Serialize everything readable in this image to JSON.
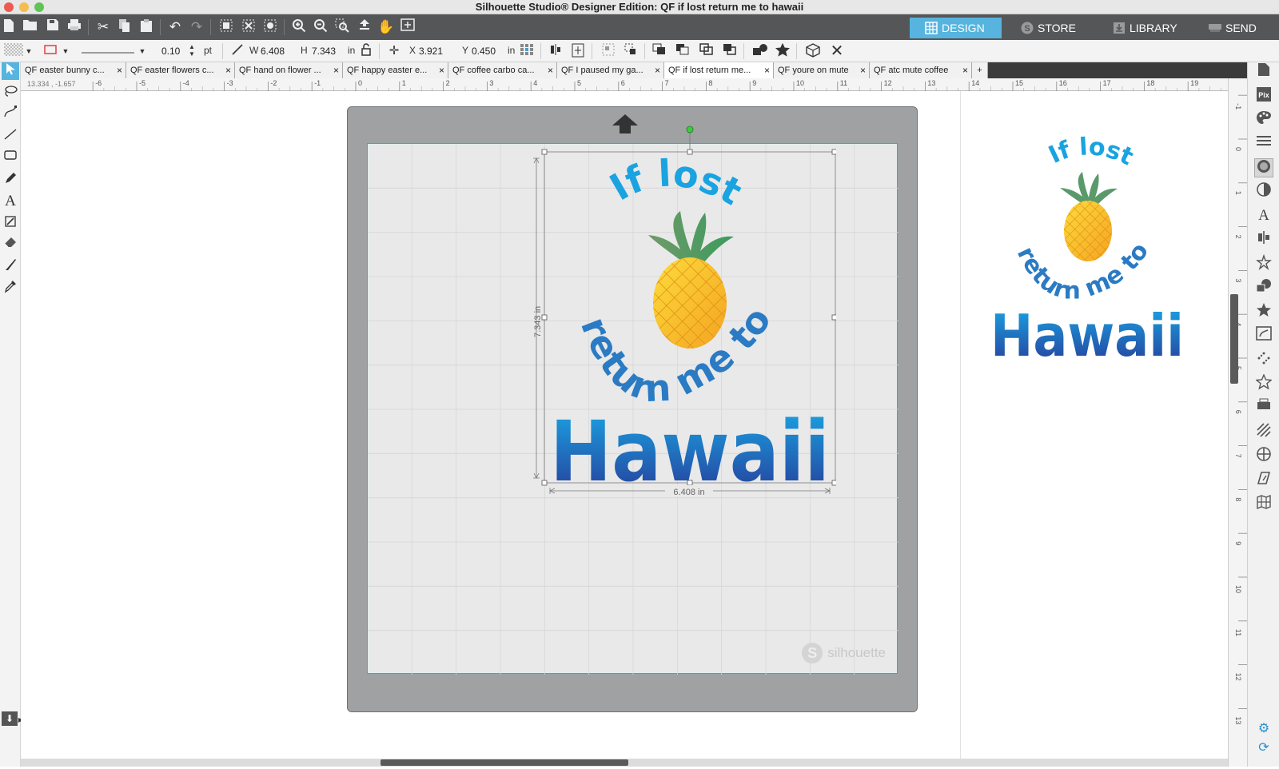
{
  "window": {
    "title": "Silhouette® Designer Edition: QF if lost return me to hawaii",
    "title_display": "Silhouette Studio® Designer Edition: QF if lost return me to hawaii"
  },
  "nav_tabs": [
    {
      "label": "DESIGN",
      "icon": "grid-icon",
      "active": true
    },
    {
      "label": "STORE",
      "icon": "silhouette-s-icon",
      "active": false
    },
    {
      "label": "LIBRARY",
      "icon": "download-icon",
      "active": false
    },
    {
      "label": "SEND",
      "icon": "cutter-icon",
      "active": false
    }
  ],
  "properties": {
    "line_width": "0.10",
    "line_unit": "pt",
    "w_label": "W",
    "width": "6.408",
    "h_label": "H",
    "height": "7.343",
    "size_unit": "in",
    "x_label": "X",
    "x": "3.921",
    "y_label": "Y",
    "y": "0.450",
    "pos_unit": "in"
  },
  "doc_tabs": [
    {
      "label": "QF easter bunny c...",
      "active": false
    },
    {
      "label": "QF easter flowers c...",
      "active": false
    },
    {
      "label": "QF hand on flower ...",
      "active": false
    },
    {
      "label": "QF happy easter e...",
      "active": false
    },
    {
      "label": "QF coffee carbo ca...",
      "active": false
    },
    {
      "label": "QF I paused my ga...",
      "active": false
    },
    {
      "label": "QF if lost return me...",
      "active": true
    },
    {
      "label": "QF youre on mute",
      "active": false
    },
    {
      "label": "QF atc mute coffee",
      "active": false
    }
  ],
  "doc_tab_close": "×",
  "doc_tab_add": "+",
  "cursor_coords": "13.334 , -1.657",
  "ruler_h_labels": [
    "-6",
    "-5",
    "-4",
    "-3",
    "-2",
    "-1",
    "0",
    "1",
    "2",
    "3",
    "4",
    "5",
    "6",
    "7",
    "8",
    "9",
    "10",
    "11",
    "12",
    "13",
    "14",
    "15",
    "16",
    "17",
    "18",
    "19"
  ],
  "ruler_v_labels": [
    "-1",
    "0",
    "1",
    "2",
    "3",
    "4",
    "5",
    "6",
    "7",
    "8",
    "9",
    "10",
    "11",
    "12",
    "13"
  ],
  "design": {
    "line1": "If lost",
    "line2": "return me to",
    "line3": "Hawaii",
    "width_dim": "6.408 in",
    "height_dim": "7.343 in"
  },
  "watermark": "silhouette",
  "watermark_letter": "S",
  "colors": {
    "toolbar_bg": "#555658",
    "accent": "#56b4de",
    "mat": "#a0a1a3",
    "cut_border": "#e46464",
    "text_light_blue": "#1aa3e0",
    "text_mid_blue": "#2a7bc4",
    "text_dark_blue": "#243a9a",
    "pineapple_yellow": "#f8c52d",
    "pineapple_leaf": "#5a9a6a"
  }
}
